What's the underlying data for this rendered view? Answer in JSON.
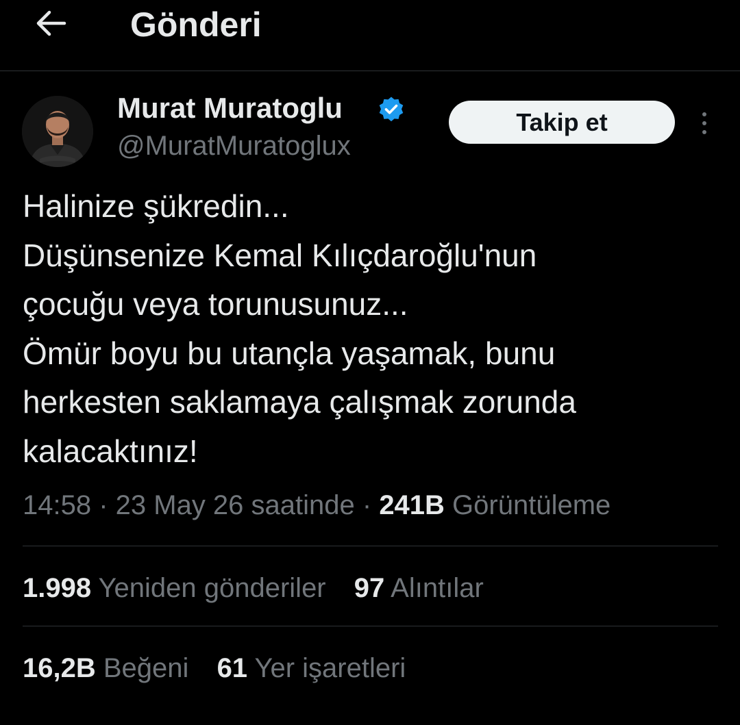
{
  "header": {
    "title": "Gönderi"
  },
  "author": {
    "name": "Murat Muratoglu",
    "handle": "@MuratMuratoglux",
    "follow_label": "Takip et"
  },
  "tweet": {
    "lines": [
      "Halinize şükredin...",
      "Düşünsenize Kemal Kılıçdaroğlu'nun",
      "çocuğu veya torunusunuz...",
      "Ömür boyu bu utançla yaşamak, bunu",
      "herkesten saklamaya çalışmak zorunda",
      "kalacaktınız!"
    ]
  },
  "meta": {
    "timestamp": "14:58 · 23 May 26 saatinde · ",
    "views_count": "241B",
    "views_label": " Görüntüleme"
  },
  "stats": {
    "retweets_count": "1.998",
    "retweets_label": "Yeniden gönderiler",
    "quotes_count": "97",
    "quotes_label": "Alıntılar",
    "likes_count": "16,2B",
    "likes_label": "Beğeni",
    "bookmarks_count": "61",
    "bookmarks_label": "Yer işaretleri"
  },
  "colors": {
    "background": "#000000",
    "text_primary": "#e7e9ea",
    "text_secondary": "#71767b",
    "divider": "#2f3336",
    "verified_blue": "#1d9bf0",
    "follow_button_bg": "#eff3f4"
  },
  "icons": {
    "back": "back-arrow-icon",
    "verified": "verified-badge-icon",
    "more": "more-vertical-icon"
  }
}
